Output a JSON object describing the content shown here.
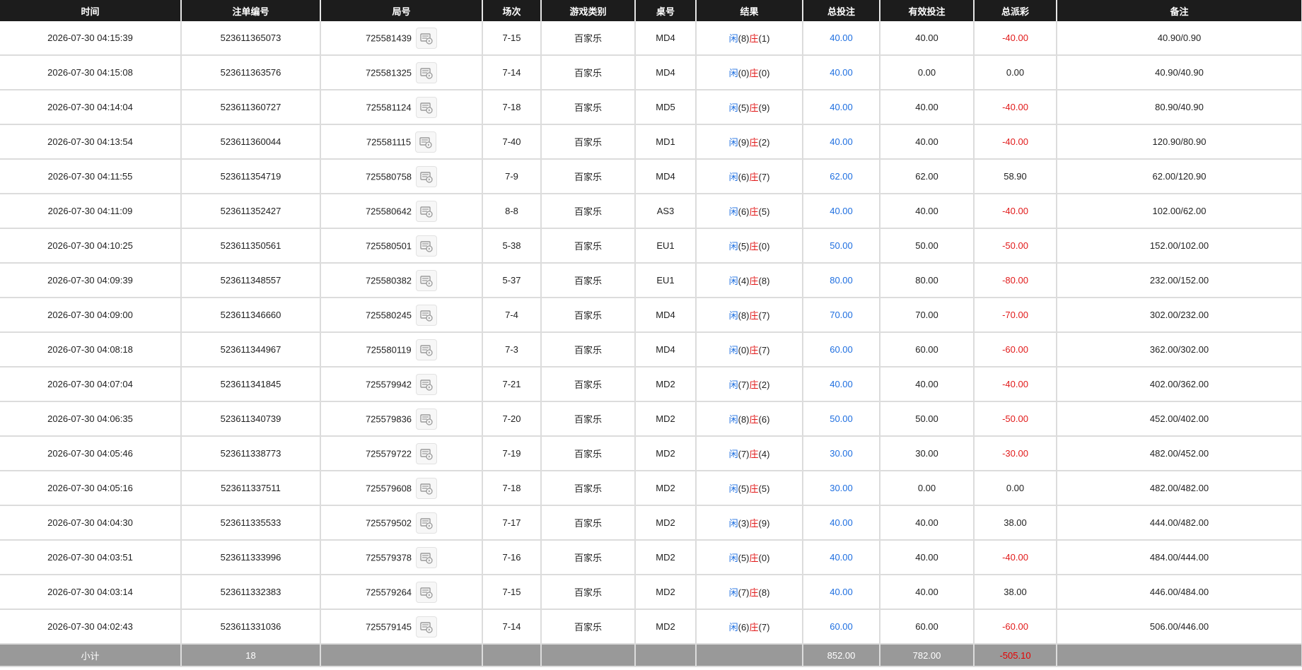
{
  "colors": {
    "header_bg": "#1c1c1c",
    "subtotal_bg": "#999999",
    "player": "#1f6fe0",
    "banker": "#e11919",
    "loss": "#e11919"
  },
  "columns": [
    "时间",
    "注单编号",
    "局号",
    "场次",
    "游戏类别",
    "桌号",
    "结果",
    "总投注",
    "有效投注",
    "总派彩",
    "备注"
  ],
  "replay_icon": "replay-icon",
  "rows": [
    {
      "time": "2026-07-30 04:15:39",
      "order": "523611365073",
      "round": "725581439",
      "session": "7-15",
      "game": "百家乐",
      "table": "MD4",
      "player_label": "闲",
      "player": "(8)",
      "banker_label": "庄",
      "banker": "(1)",
      "total_bet": "40.00",
      "valid_bet": "40.00",
      "payout": "-40.00",
      "payout_neg": true,
      "note": "40.90/0.90"
    },
    {
      "time": "2026-07-30 04:15:08",
      "order": "523611363576",
      "round": "725581325",
      "session": "7-14",
      "game": "百家乐",
      "table": "MD4",
      "player_label": "闲",
      "player": "(0)",
      "banker_label": "庄",
      "banker": "(0)",
      "total_bet": "40.00",
      "valid_bet": "0.00",
      "payout": "0.00",
      "payout_neg": false,
      "note": "40.90/40.90"
    },
    {
      "time": "2026-07-30 04:14:04",
      "order": "523611360727",
      "round": "725581124",
      "session": "7-18",
      "game": "百家乐",
      "table": "MD5",
      "player_label": "闲",
      "player": "(5)",
      "banker_label": "庄",
      "banker": "(9)",
      "total_bet": "40.00",
      "valid_bet": "40.00",
      "payout": "-40.00",
      "payout_neg": true,
      "note": "80.90/40.90"
    },
    {
      "time": "2026-07-30 04:13:54",
      "order": "523611360044",
      "round": "725581115",
      "session": "7-40",
      "game": "百家乐",
      "table": "MD1",
      "player_label": "闲",
      "player": "(9)",
      "banker_label": "庄",
      "banker": "(2)",
      "total_bet": "40.00",
      "valid_bet": "40.00",
      "payout": "-40.00",
      "payout_neg": true,
      "note": "120.90/80.90"
    },
    {
      "time": "2026-07-30 04:11:55",
      "order": "523611354719",
      "round": "725580758",
      "session": "7-9",
      "game": "百家乐",
      "table": "MD4",
      "player_label": "闲",
      "player": "(6)",
      "banker_label": "庄",
      "banker": "(7)",
      "total_bet": "62.00",
      "valid_bet": "62.00",
      "payout": "58.90",
      "payout_neg": false,
      "note": "62.00/120.90"
    },
    {
      "time": "2026-07-30 04:11:09",
      "order": "523611352427",
      "round": "725580642",
      "session": "8-8",
      "game": "百家乐",
      "table": "AS3",
      "player_label": "闲",
      "player": "(6)",
      "banker_label": "庄",
      "banker": "(5)",
      "total_bet": "40.00",
      "valid_bet": "40.00",
      "payout": "-40.00",
      "payout_neg": true,
      "note": "102.00/62.00"
    },
    {
      "time": "2026-07-30 04:10:25",
      "order": "523611350561",
      "round": "725580501",
      "session": "5-38",
      "game": "百家乐",
      "table": "EU1",
      "player_label": "闲",
      "player": "(5)",
      "banker_label": "庄",
      "banker": "(0)",
      "total_bet": "50.00",
      "valid_bet": "50.00",
      "payout": "-50.00",
      "payout_neg": true,
      "note": "152.00/102.00"
    },
    {
      "time": "2026-07-30 04:09:39",
      "order": "523611348557",
      "round": "725580382",
      "session": "5-37",
      "game": "百家乐",
      "table": "EU1",
      "player_label": "闲",
      "player": "(4)",
      "banker_label": "庄",
      "banker": "(8)",
      "total_bet": "80.00",
      "valid_bet": "80.00",
      "payout": "-80.00",
      "payout_neg": true,
      "note": "232.00/152.00"
    },
    {
      "time": "2026-07-30 04:09:00",
      "order": "523611346660",
      "round": "725580245",
      "session": "7-4",
      "game": "百家乐",
      "table": "MD4",
      "player_label": "闲",
      "player": "(8)",
      "banker_label": "庄",
      "banker": "(7)",
      "total_bet": "70.00",
      "valid_bet": "70.00",
      "payout": "-70.00",
      "payout_neg": true,
      "note": "302.00/232.00"
    },
    {
      "time": "2026-07-30 04:08:18",
      "order": "523611344967",
      "round": "725580119",
      "session": "7-3",
      "game": "百家乐",
      "table": "MD4",
      "player_label": "闲",
      "player": "(0)",
      "banker_label": "庄",
      "banker": "(7)",
      "total_bet": "60.00",
      "valid_bet": "60.00",
      "payout": "-60.00",
      "payout_neg": true,
      "note": "362.00/302.00"
    },
    {
      "time": "2026-07-30 04:07:04",
      "order": "523611341845",
      "round": "725579942",
      "session": "7-21",
      "game": "百家乐",
      "table": "MD2",
      "player_label": "闲",
      "player": "(7)",
      "banker_label": "庄",
      "banker": "(2)",
      "total_bet": "40.00",
      "valid_bet": "40.00",
      "payout": "-40.00",
      "payout_neg": true,
      "note": "402.00/362.00"
    },
    {
      "time": "2026-07-30 04:06:35",
      "order": "523611340739",
      "round": "725579836",
      "session": "7-20",
      "game": "百家乐",
      "table": "MD2",
      "player_label": "闲",
      "player": "(8)",
      "banker_label": "庄",
      "banker": "(6)",
      "total_bet": "50.00",
      "valid_bet": "50.00",
      "payout": "-50.00",
      "payout_neg": true,
      "note": "452.00/402.00"
    },
    {
      "time": "2026-07-30 04:05:46",
      "order": "523611338773",
      "round": "725579722",
      "session": "7-19",
      "game": "百家乐",
      "table": "MD2",
      "player_label": "闲",
      "player": "(7)",
      "banker_label": "庄",
      "banker": "(4)",
      "total_bet": "30.00",
      "valid_bet": "30.00",
      "payout": "-30.00",
      "payout_neg": true,
      "note": "482.00/452.00"
    },
    {
      "time": "2026-07-30 04:05:16",
      "order": "523611337511",
      "round": "725579608",
      "session": "7-18",
      "game": "百家乐",
      "table": "MD2",
      "player_label": "闲",
      "player": "(5)",
      "banker_label": "庄",
      "banker": "(5)",
      "total_bet": "30.00",
      "valid_bet": "0.00",
      "payout": "0.00",
      "payout_neg": false,
      "note": "482.00/482.00"
    },
    {
      "time": "2026-07-30 04:04:30",
      "order": "523611335533",
      "round": "725579502",
      "session": "7-17",
      "game": "百家乐",
      "table": "MD2",
      "player_label": "闲",
      "player": "(3)",
      "banker_label": "庄",
      "banker": "(9)",
      "total_bet": "40.00",
      "valid_bet": "40.00",
      "payout": "38.00",
      "payout_neg": false,
      "note": "444.00/482.00"
    },
    {
      "time": "2026-07-30 04:03:51",
      "order": "523611333996",
      "round": "725579378",
      "session": "7-16",
      "game": "百家乐",
      "table": "MD2",
      "player_label": "闲",
      "player": "(5)",
      "banker_label": "庄",
      "banker": "(0)",
      "total_bet": "40.00",
      "valid_bet": "40.00",
      "payout": "-40.00",
      "payout_neg": true,
      "note": "484.00/444.00"
    },
    {
      "time": "2026-07-30 04:03:14",
      "order": "523611332383",
      "round": "725579264",
      "session": "7-15",
      "game": "百家乐",
      "table": "MD2",
      "player_label": "闲",
      "player": "(7)",
      "banker_label": "庄",
      "banker": "(8)",
      "total_bet": "40.00",
      "valid_bet": "40.00",
      "payout": "38.00",
      "payout_neg": false,
      "note": "446.00/484.00"
    },
    {
      "time": "2026-07-30 04:02:43",
      "order": "523611331036",
      "round": "725579145",
      "session": "7-14",
      "game": "百家乐",
      "table": "MD2",
      "player_label": "闲",
      "player": "(6)",
      "banker_label": "庄",
      "banker": "(7)",
      "total_bet": "60.00",
      "valid_bet": "60.00",
      "payout": "-60.00",
      "payout_neg": true,
      "note": "506.00/446.00"
    }
  ],
  "subtotal": {
    "label": "小计",
    "count": "18",
    "total_bet": "852.00",
    "valid_bet": "782.00",
    "payout": "-505.10"
  }
}
